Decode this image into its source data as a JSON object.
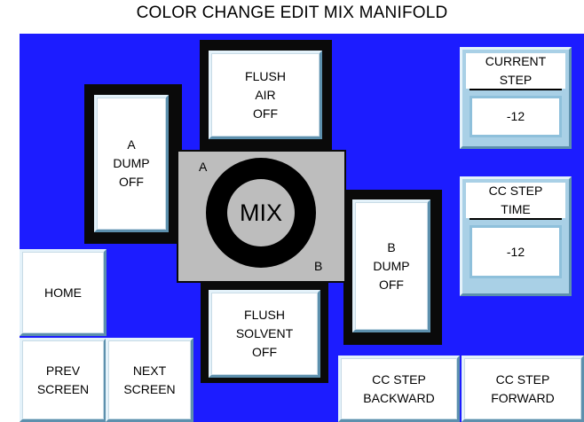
{
  "screen": {
    "title": "COLOR CHANGE EDIT MIX MANIFOLD",
    "background_color": "#1c1cff"
  },
  "valves": {
    "flush_air": "FLUSH\nAIR\nOFF",
    "a_dump": "A\nDUMP\nOFF",
    "b_dump": "B\nDUMP\nOFF",
    "flush_solvent": "FLUSH\nSOLVENT\nOFF"
  },
  "mix": {
    "label": "MIX",
    "port_a": "A",
    "port_b": "B"
  },
  "current_step": {
    "label": "CURRENT\nSTEP",
    "value": "-12"
  },
  "cc_step_time": {
    "label": "CC STEP\nTIME",
    "value": "-12"
  },
  "nav": {
    "home": "HOME",
    "prev_screen": "PREV\nSCREEN",
    "next_screen": "NEXT\nSCREEN",
    "cc_step_backward": "CC STEP\nBACKWARD",
    "cc_step_forward": "CC STEP\nFORWARD"
  }
}
